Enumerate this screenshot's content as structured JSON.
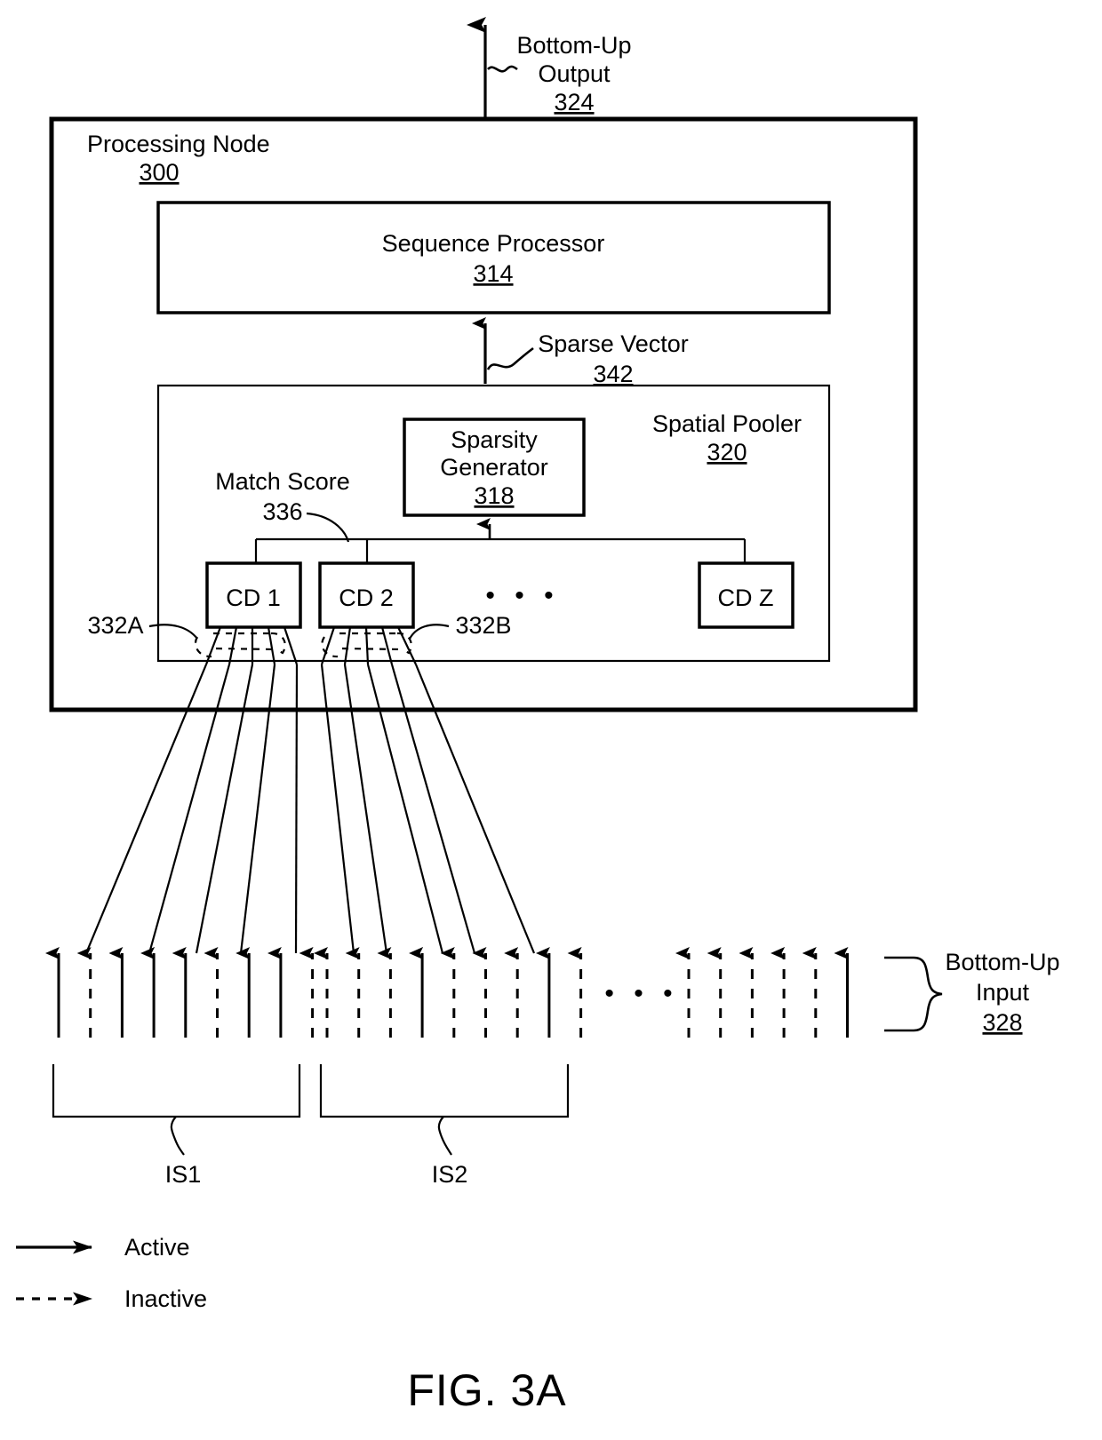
{
  "figure": {
    "caption": "FIG. 3A"
  },
  "labels": {
    "bottom_up_output": {
      "line1": "Bottom-Up",
      "line2": "Output",
      "ref": "324"
    },
    "processing_node": {
      "title": "Processing Node",
      "ref": "300"
    },
    "sequence_processor": {
      "title": "Sequence Processor",
      "ref": "314"
    },
    "sparse_vector": {
      "title": "Sparse Vector",
      "ref": "342"
    },
    "spatial_pooler": {
      "title": "Spatial Pooler",
      "ref": "320"
    },
    "sparsity_generator": {
      "line1": "Sparsity",
      "line2": "Generator",
      "ref": "318"
    },
    "match_score": {
      "title": "Match Score",
      "ref": "336"
    },
    "bottom_up_input": {
      "line1": "Bottom-Up",
      "line2": "Input",
      "ref": "328"
    }
  },
  "cells": [
    {
      "name": "CD 1"
    },
    {
      "name": "CD 2"
    },
    {
      "name": "CD Z"
    }
  ],
  "ellipsis": "• • •",
  "dendrite_refs": {
    "left": "332A",
    "right": "332B"
  },
  "input_spaces": [
    {
      "name": "IS1"
    },
    {
      "name": "IS2"
    }
  ],
  "legend": [
    {
      "label": "Active",
      "style": "solid"
    },
    {
      "label": "Inactive",
      "style": "dashed"
    }
  ],
  "input_arrows": {
    "group1_states": [
      "active",
      "inactive",
      "active",
      "active",
      "active",
      "inactive",
      "active",
      "active",
      "inactive"
    ],
    "group2_states": [
      "inactive",
      "inactive",
      "inactive",
      "active",
      "inactive",
      "inactive",
      "inactive",
      "active",
      "inactive"
    ],
    "group3_states": [
      "inactive",
      "inactive",
      "inactive",
      "inactive",
      "inactive",
      "active"
    ]
  },
  "colors": {
    "stroke": "#000000",
    "background": "#ffffff"
  }
}
